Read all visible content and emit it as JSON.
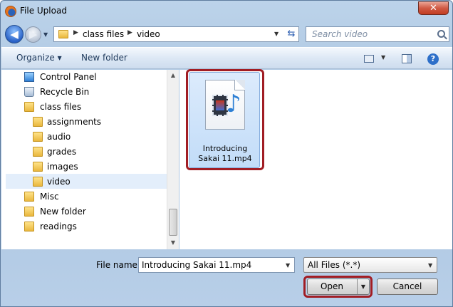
{
  "window": {
    "title": "File Upload",
    "close_glyph": "✕"
  },
  "address": {
    "breadcrumbs": [
      "class files",
      "video"
    ],
    "search_placeholder": "Search video"
  },
  "toolbar": {
    "organize_label": "Organize ▾",
    "new_folder_label": "New folder",
    "help_glyph": "?"
  },
  "nav_pane": {
    "items": [
      {
        "label": "Control Panel",
        "icon": "control-panel-icon"
      },
      {
        "label": "Recycle Bin",
        "icon": "recycle-bin-icon"
      },
      {
        "label": "class files",
        "icon": "folder-icon"
      },
      {
        "label": "assignments",
        "icon": "folder-icon"
      },
      {
        "label": "audio",
        "icon": "folder-icon"
      },
      {
        "label": "grades",
        "icon": "folder-icon"
      },
      {
        "label": "images",
        "icon": "folder-icon"
      },
      {
        "label": "video",
        "icon": "folder-icon",
        "selected": true
      },
      {
        "label": "Misc",
        "icon": "folder-icon"
      },
      {
        "label": "New folder",
        "icon": "folder-icon"
      },
      {
        "label": "readings",
        "icon": "folder-icon"
      }
    ]
  },
  "content": {
    "files": [
      {
        "name": "Introducing Sakai 11.mp4",
        "icon": "video-file-icon",
        "selected": true
      }
    ]
  },
  "bottom": {
    "file_name_label": "File name:",
    "file_name_value": "Introducing Sakai 11.mp4",
    "filter_value": "All Files (*.*)",
    "open_label": "Open",
    "cancel_label": "Cancel"
  },
  "colors": {
    "highlight_ring": "#a11d24",
    "selection": "#c2dcf8"
  }
}
